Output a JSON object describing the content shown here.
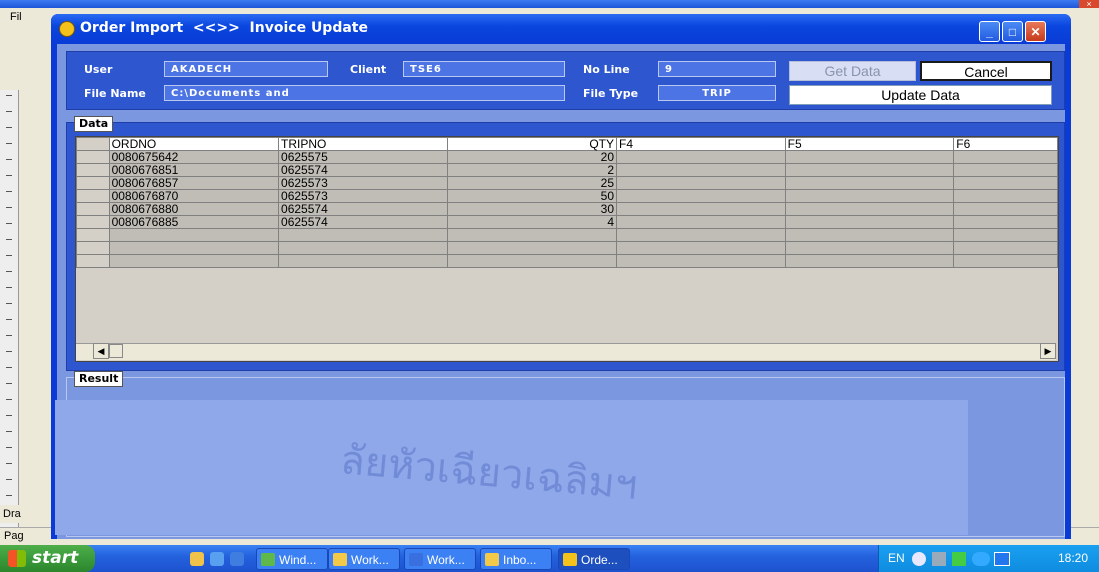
{
  "dialog": {
    "title": "Order Import  <<>>  Invoice Update",
    "min_label": "_",
    "max_label": "□",
    "close_label": "✕"
  },
  "header": {
    "user_label": "User",
    "user_value": "AKADECH",
    "client_label": "Client",
    "client_value": "TSE6",
    "noline_label": "No Line",
    "noline_value": "9",
    "filename_label": "File Name",
    "filename_value": "C:\\Documents and",
    "filetype_label": "File Type",
    "filetype_value": "TRIP",
    "get_data_label": "Get Data",
    "cancel_label": "Cancel",
    "update_label": "Update Data"
  },
  "data_group": {
    "title": "Data",
    "columns": [
      "ORDNO",
      "TRIPNO",
      "QTY",
      "F4",
      "F5",
      "F6"
    ],
    "rows": [
      [
        "0080675642",
        "0625575",
        "20",
        "",
        "",
        ""
      ],
      [
        "0080676851",
        "0625574",
        "2",
        "",
        "",
        ""
      ],
      [
        "0080676857",
        "0625573",
        "25",
        "",
        "",
        ""
      ],
      [
        "0080676870",
        "0625573",
        "50",
        "",
        "",
        ""
      ],
      [
        "0080676880",
        "0625574",
        "30",
        "",
        "",
        ""
      ],
      [
        "0080676885",
        "0625574",
        "4",
        "",
        "",
        ""
      ]
    ]
  },
  "result_group": {
    "title": "Result"
  },
  "taskbar": {
    "start_label": "start",
    "tasks": [
      {
        "label": "Wind...",
        "icon_color": "#5fb84a"
      },
      {
        "label": "Work...",
        "icon_color": "#f3c94a"
      },
      {
        "label": "Work...",
        "icon_color": "#3a6fe0"
      },
      {
        "label": "Inbo...",
        "icon_color": "#f3c94a"
      },
      {
        "label": "Orde...",
        "icon_color": "#f4c21a"
      }
    ],
    "language": "EN",
    "clock": "18:20"
  },
  "background_app": {
    "menu_fragment": "Fil",
    "status_fragment": "Pag",
    "draw_fragment": "Dra"
  }
}
